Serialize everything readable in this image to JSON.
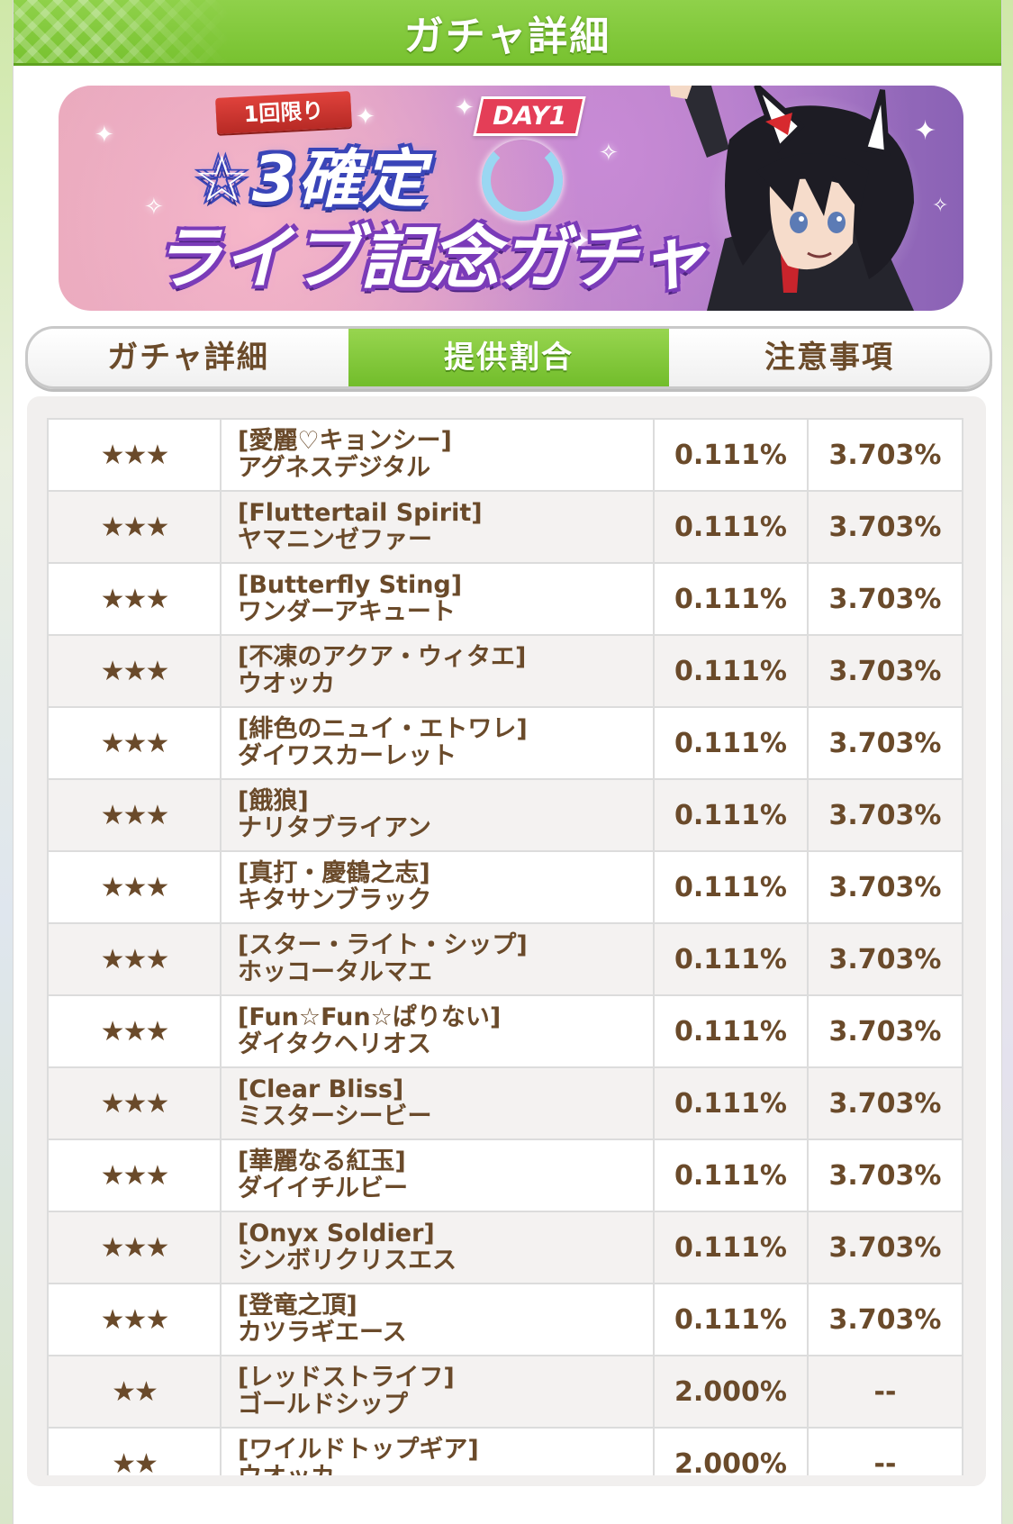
{
  "header": {
    "title": "ガチャ詳細"
  },
  "banner": {
    "ribbon": "1回限り",
    "day_tag": "DAY1",
    "title_line1": "☆3確定",
    "title_line2": "ライブ記念ガチャ"
  },
  "tabs": [
    {
      "label": "ガチャ詳細",
      "active": false
    },
    {
      "label": "提供割合",
      "active": true
    },
    {
      "label": "注意事項",
      "active": false
    }
  ],
  "table": {
    "rows": [
      {
        "rarity": "★★★",
        "title": "[愛麗♡キョンシー]",
        "name": "アグネスデジタル",
        "rate": "0.111%",
        "rate2": "3.703%"
      },
      {
        "rarity": "★★★",
        "title": "[Fluttertail Spirit]",
        "name": "ヤマニンゼファー",
        "rate": "0.111%",
        "rate2": "3.703%"
      },
      {
        "rarity": "★★★",
        "title": "[Butterfly Sting]",
        "name": "ワンダーアキュート",
        "rate": "0.111%",
        "rate2": "3.703%"
      },
      {
        "rarity": "★★★",
        "title": "[不凍のアクア・ウィタエ]",
        "name": "ウオッカ",
        "rate": "0.111%",
        "rate2": "3.703%"
      },
      {
        "rarity": "★★★",
        "title": "[緋色のニュイ・エトワレ]",
        "name": "ダイワスカーレット",
        "rate": "0.111%",
        "rate2": "3.703%"
      },
      {
        "rarity": "★★★",
        "title": "[餓狼]",
        "name": "ナリタブライアン",
        "rate": "0.111%",
        "rate2": "3.703%"
      },
      {
        "rarity": "★★★",
        "title": "[真打・慶鶴之志]",
        "name": "キタサンブラック",
        "rate": "0.111%",
        "rate2": "3.703%"
      },
      {
        "rarity": "★★★",
        "title": "[スター・ライト・シップ]",
        "name": "ホッコータルマエ",
        "rate": "0.111%",
        "rate2": "3.703%"
      },
      {
        "rarity": "★★★",
        "title": "[Fun☆Fun☆ぱりない]",
        "name": "ダイタクヘリオス",
        "rate": "0.111%",
        "rate2": "3.703%"
      },
      {
        "rarity": "★★★",
        "title": "[Clear Bliss]",
        "name": "ミスターシービー",
        "rate": "0.111%",
        "rate2": "3.703%"
      },
      {
        "rarity": "★★★",
        "title": "[華麗なる紅玉]",
        "name": "ダイイチルビー",
        "rate": "0.111%",
        "rate2": "3.703%"
      },
      {
        "rarity": "★★★",
        "title": "[Onyx Soldier]",
        "name": "シンボリクリスエス",
        "rate": "0.111%",
        "rate2": "3.703%"
      },
      {
        "rarity": "★★★",
        "title": "[登竜之頂]",
        "name": "カツラギエース",
        "rate": "0.111%",
        "rate2": "3.703%"
      },
      {
        "rarity": "★★",
        "title": "[レッドストライフ]",
        "name": "ゴールドシップ",
        "rate": "2.000%",
        "rate2": "--"
      },
      {
        "rarity": "★★",
        "title": "[ワイルドトップギア]",
        "name": "ウオッカ",
        "rate": "2.000%",
        "rate2": "--"
      }
    ]
  }
}
